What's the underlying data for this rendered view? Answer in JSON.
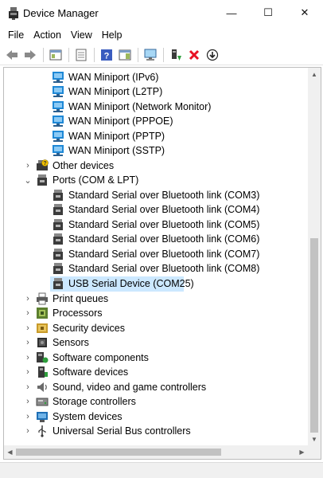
{
  "window": {
    "title": "Device Manager",
    "minimize_glyph": "—",
    "maximize_glyph": "☐",
    "close_glyph": "✕"
  },
  "menu": [
    "File",
    "Action",
    "View",
    "Help"
  ],
  "toolbar": [
    "back-arrow-icon",
    "forward-arrow-icon",
    "show-hide-console-tree-icon",
    "properties-icon",
    "help-icon",
    "action-pane-icon",
    "scan-hardware-icon",
    "update-driver-icon",
    "uninstall-device-icon",
    "disable-device-icon"
  ],
  "tree": {
    "network_children": [
      "WAN Miniport (IPv6)",
      "WAN Miniport (L2TP)",
      "WAN Miniport (Network Monitor)",
      "WAN Miniport (PPPOE)",
      "WAN Miniport (PPTP)",
      "WAN Miniport (SSTP)"
    ],
    "other_devices": "Other devices",
    "ports": "Ports (COM & LPT)",
    "port_children": [
      "Standard Serial over Bluetooth link (COM3)",
      "Standard Serial over Bluetooth link (COM4)",
      "Standard Serial over Bluetooth link (COM5)",
      "Standard Serial over Bluetooth link (COM6)",
      "Standard Serial over Bluetooth link (COM7)",
      "Standard Serial over Bluetooth link (COM8)",
      "USB Serial Device (COM25)"
    ],
    "categories": [
      "Print queues",
      "Processors",
      "Security devices",
      "Sensors",
      "Software components",
      "Software devices",
      "Sound, video and game controllers",
      "Storage controllers",
      "System devices",
      "Universal Serial Bus controllers"
    ]
  },
  "colors": {
    "selection": "#cce8ff",
    "uninstall_red": "#e81123",
    "help_blue": "#3a5cbf",
    "network_blue": "#1e88d6"
  }
}
